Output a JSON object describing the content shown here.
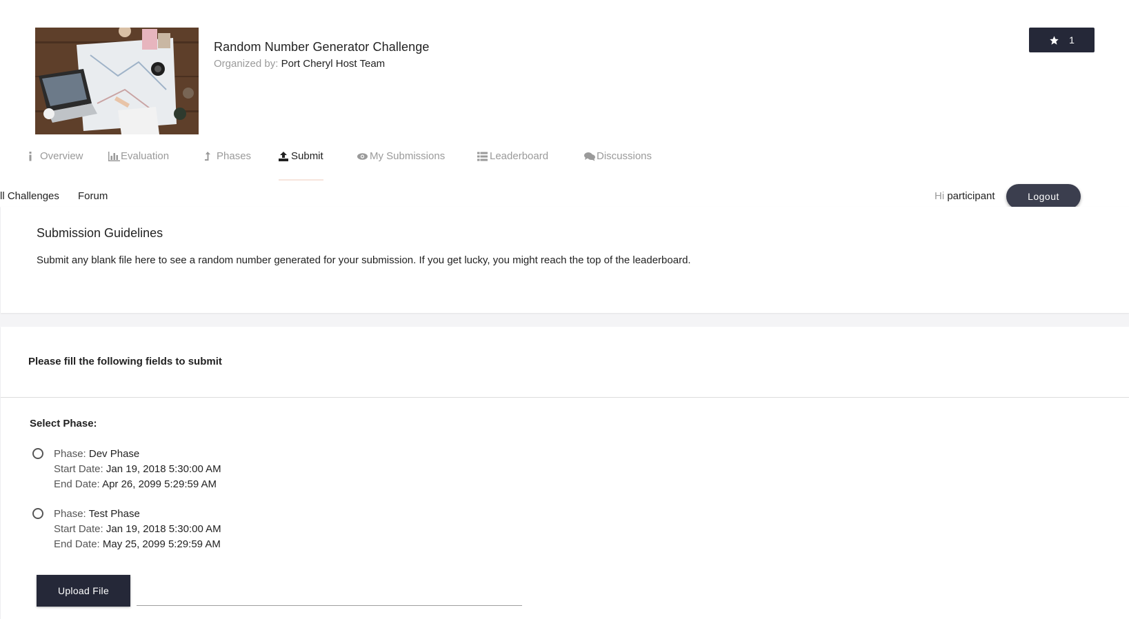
{
  "challenge": {
    "title": "Random Number Generator Challenge",
    "organized_by_label": "Organized by:",
    "organizer": "Port Cheryl Host Team",
    "star_count": "1"
  },
  "tabs": [
    {
      "label": "Overview",
      "icon": "info-icon",
      "active": false
    },
    {
      "label": "Evaluation",
      "icon": "bar-chart-icon",
      "active": false
    },
    {
      "label": "Phases",
      "icon": "level-up-icon",
      "active": false
    },
    {
      "label": "Submit",
      "icon": "upload-icon",
      "active": true
    },
    {
      "label": "My Submissions",
      "icon": "eye-icon",
      "active": false
    },
    {
      "label": "Leaderboard",
      "icon": "list-icon",
      "active": false
    },
    {
      "label": "Discussions",
      "icon": "comments-icon",
      "active": false
    }
  ],
  "subnav": {
    "all_challenges": "ll Challenges",
    "forum": "Forum",
    "hi": "Hi",
    "username": "participant",
    "logout": "Logout"
  },
  "guidelines": {
    "title": "Submission Guidelines",
    "text": "Submit any blank file here to see a random number generated for your submission. If you get lucky, you might reach the top of the leaderboard."
  },
  "form": {
    "heading": "Please fill the following fields to submit",
    "select_phase_label": "Select Phase:",
    "phase_label": "Phase:",
    "start_label": "Start Date:",
    "end_label": "End Date:",
    "phases": [
      {
        "name": "Dev Phase",
        "start": "Jan 19, 2018 5:30:00 AM",
        "end": "Apr 26, 2099 5:29:59 AM",
        "selected": false
      },
      {
        "name": "Test Phase",
        "start": "Jan 19, 2018 5:30:00 AM",
        "end": "May 25, 2099 5:29:59 AM",
        "selected": false
      }
    ],
    "upload_label": "Upload File"
  },
  "colors": {
    "primary_dark": "#252838",
    "logout_bg": "#3b3e4e",
    "muted_text": "#9a9a9a",
    "active_tab_underline": "#f7e4dc"
  }
}
